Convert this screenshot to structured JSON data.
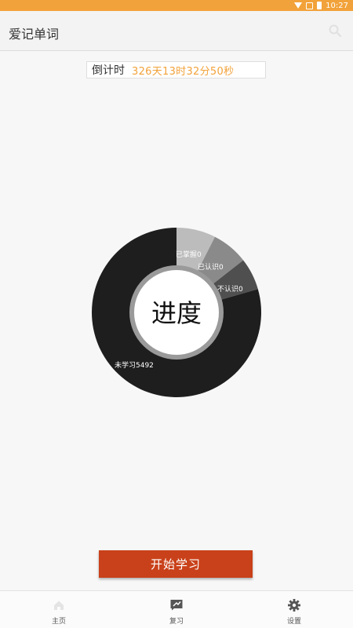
{
  "status_bar": {
    "time": "10:27",
    "color": "#f2a23a"
  },
  "app_bar": {
    "title": "爱记单词",
    "search_icon": "search-icon"
  },
  "countdown": {
    "label": "倒计时",
    "value": "326天13时32分50秒",
    "value_color": "#f2a23a"
  },
  "chart_data": {
    "type": "pie",
    "center_label": "进度",
    "slice_labels": [
      "已掌握0",
      "已认识0",
      "不认识0",
      "未学习5492"
    ],
    "slices": [
      {
        "value": 0,
        "color": "#bcbcbc"
      },
      {
        "value": 0,
        "color": "#8a8a8a"
      },
      {
        "value": 0,
        "color": "#4f4f4f"
      },
      {
        "value": 5492,
        "color": "#1e1e1e"
      }
    ]
  },
  "start_button": {
    "label": "开始学习",
    "color": "#c9411a"
  },
  "bottom_nav": {
    "items": [
      {
        "label": "主页",
        "icon": "home-icon"
      },
      {
        "label": "复习",
        "icon": "review-icon"
      },
      {
        "label": "设置",
        "icon": "gear-icon"
      }
    ]
  }
}
